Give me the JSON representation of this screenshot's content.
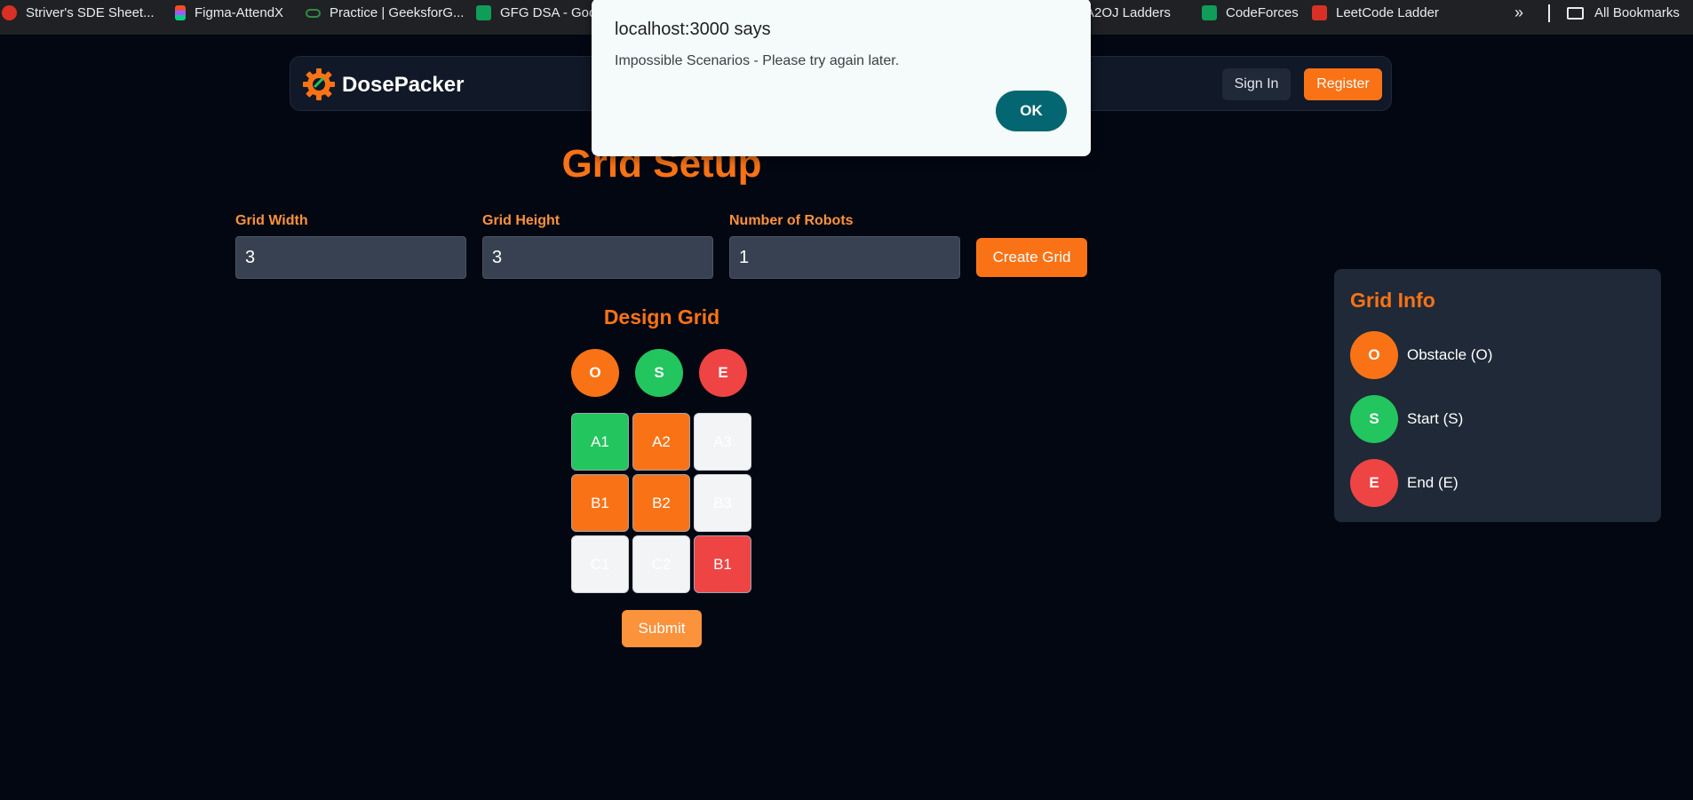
{
  "bookmarks": {
    "items": [
      {
        "label": "Striver's SDE Sheet...",
        "icon": "tuf-icon",
        "color": "#d93025"
      },
      {
        "label": "Figma-AttendX",
        "icon": "figma-icon",
        "color": "#f24e1e"
      },
      {
        "label": "Practice | GeeksforG...",
        "icon": "gfg-icon",
        "color": "#2f8d46"
      },
      {
        "label": "GFG DSA - Goo",
        "icon": "sheets-icon",
        "color": "#0f9d58"
      },
      {
        "label": "A2OJ Ladders",
        "icon": "globe-icon",
        "color": "#9aa0a6"
      },
      {
        "label": "CodeForces",
        "icon": "sheets-icon",
        "color": "#0f9d58"
      },
      {
        "label": "LeetCode Ladder",
        "icon": "leetcode-icon",
        "color": "#d93025"
      }
    ],
    "more": "»",
    "all_bookmarks": "All Bookmarks"
  },
  "navbar": {
    "brand": "DosePacker",
    "sign_in": "Sign In",
    "register": "Register"
  },
  "setup": {
    "title": "Grid Setup",
    "fields": [
      {
        "label": "Grid Width",
        "value": "3"
      },
      {
        "label": "Grid Height",
        "value": "3"
      },
      {
        "label": "Number of Robots",
        "value": "1"
      }
    ],
    "create_button": "Create Grid"
  },
  "design": {
    "title": "Design Grid",
    "tools": [
      {
        "label": "O",
        "color": "#f97316"
      },
      {
        "label": "S",
        "color": "#22c55e"
      },
      {
        "label": "E",
        "color": "#ef4444"
      }
    ],
    "cells": [
      [
        {
          "label": "A1",
          "state": "start"
        },
        {
          "label": "A2",
          "state": "obstacle"
        },
        {
          "label": "A3",
          "state": "empty"
        }
      ],
      [
        {
          "label": "B1",
          "state": "obstacle"
        },
        {
          "label": "B2",
          "state": "obstacle"
        },
        {
          "label": "B3",
          "state": "empty"
        }
      ],
      [
        {
          "label": "C1",
          "state": "empty"
        },
        {
          "label": "C2",
          "state": "empty"
        },
        {
          "label": "B1",
          "state": "end"
        }
      ]
    ],
    "submit": "Submit"
  },
  "grid_info": {
    "title": "Grid Info",
    "legend": [
      {
        "symbol": "O",
        "label": "Obstacle (O)",
        "color": "#f97316"
      },
      {
        "symbol": "S",
        "label": "Start (S)",
        "color": "#22c55e"
      },
      {
        "symbol": "E",
        "label": "End (E)",
        "color": "#ef4444"
      }
    ]
  },
  "alert": {
    "title": "localhost:3000 says",
    "message": "Impossible Scenarios - Please try again later.",
    "ok": "OK"
  },
  "colors": {
    "accent": "#f97316",
    "start": "#22c55e",
    "end": "#ef4444",
    "empty": "#f3f4f6"
  }
}
